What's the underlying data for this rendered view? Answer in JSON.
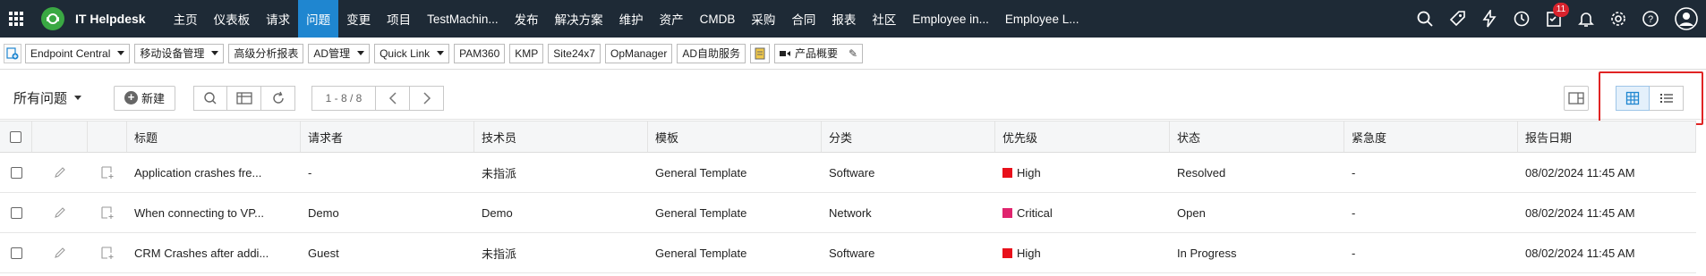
{
  "app": {
    "title": "IT Helpdesk",
    "nav": [
      "主页",
      "仪表板",
      "请求",
      "问题",
      "变更",
      "项目",
      "TestMachin...",
      "发布",
      "解决方案",
      "维护",
      "资产",
      "CMDB",
      "采购",
      "合同",
      "报表",
      "社区",
      "Employee in...",
      "Employee L..."
    ],
    "active_nav_index": 3,
    "notification_count": "11",
    "icons": [
      "search-icon",
      "rocket-icon",
      "lightning-icon",
      "history-icon",
      "tasks-icon",
      "bell-icon",
      "gear-icon",
      "help-icon",
      "user-avatar-icon"
    ],
    "accent_color": "#1f86d0",
    "nav_bg": "#1e2a36"
  },
  "quickbar": {
    "items": [
      {
        "label": "Endpoint Central",
        "dropdown": true
      },
      {
        "label": "移动设备管理",
        "dropdown": true
      },
      {
        "label": "高级分析报表",
        "dropdown": false
      },
      {
        "label": "AD管理",
        "dropdown": true
      },
      {
        "label": "Quick Link",
        "dropdown": true
      },
      {
        "label": "PAM360",
        "dropdown": false
      },
      {
        "label": "KMP",
        "dropdown": false
      },
      {
        "label": "Site24x7",
        "dropdown": false
      },
      {
        "label": "OpManager",
        "dropdown": false
      },
      {
        "label": "AD自助服务",
        "dropdown": false
      }
    ],
    "product_overview": "产品概要"
  },
  "toolbar": {
    "view_label": "所有问题",
    "new_label": "新建",
    "pager_range": "1 - 8 / 8"
  },
  "table": {
    "columns": [
      "标题",
      "请求者",
      "技术员",
      "模板",
      "分类",
      "优先级",
      "状态",
      "紧急度",
      "报告日期"
    ],
    "rows": [
      {
        "title": "Application crashes fre...",
        "requester": "-",
        "technician": "未指派",
        "template": "General Template",
        "category": "Software",
        "priority": "High",
        "priority_color": "#e8101b",
        "status": "Resolved",
        "urgency": "-",
        "date": "08/02/2024 11:45 AM"
      },
      {
        "title": "When connecting to VP...",
        "requester": "Demo",
        "technician": "Demo",
        "template": "General Template",
        "category": "Network",
        "priority": "Critical",
        "priority_color": "#e0246e",
        "status": "Open",
        "urgency": "-",
        "date": "08/02/2024 11:45 AM"
      },
      {
        "title": "CRM Crashes after addi...",
        "requester": "Guest",
        "technician": "未指派",
        "template": "General Template",
        "category": "Software",
        "priority": "High",
        "priority_color": "#e8101b",
        "status": "In Progress",
        "urgency": "-",
        "date": "08/02/2024 11:45 AM"
      }
    ]
  }
}
